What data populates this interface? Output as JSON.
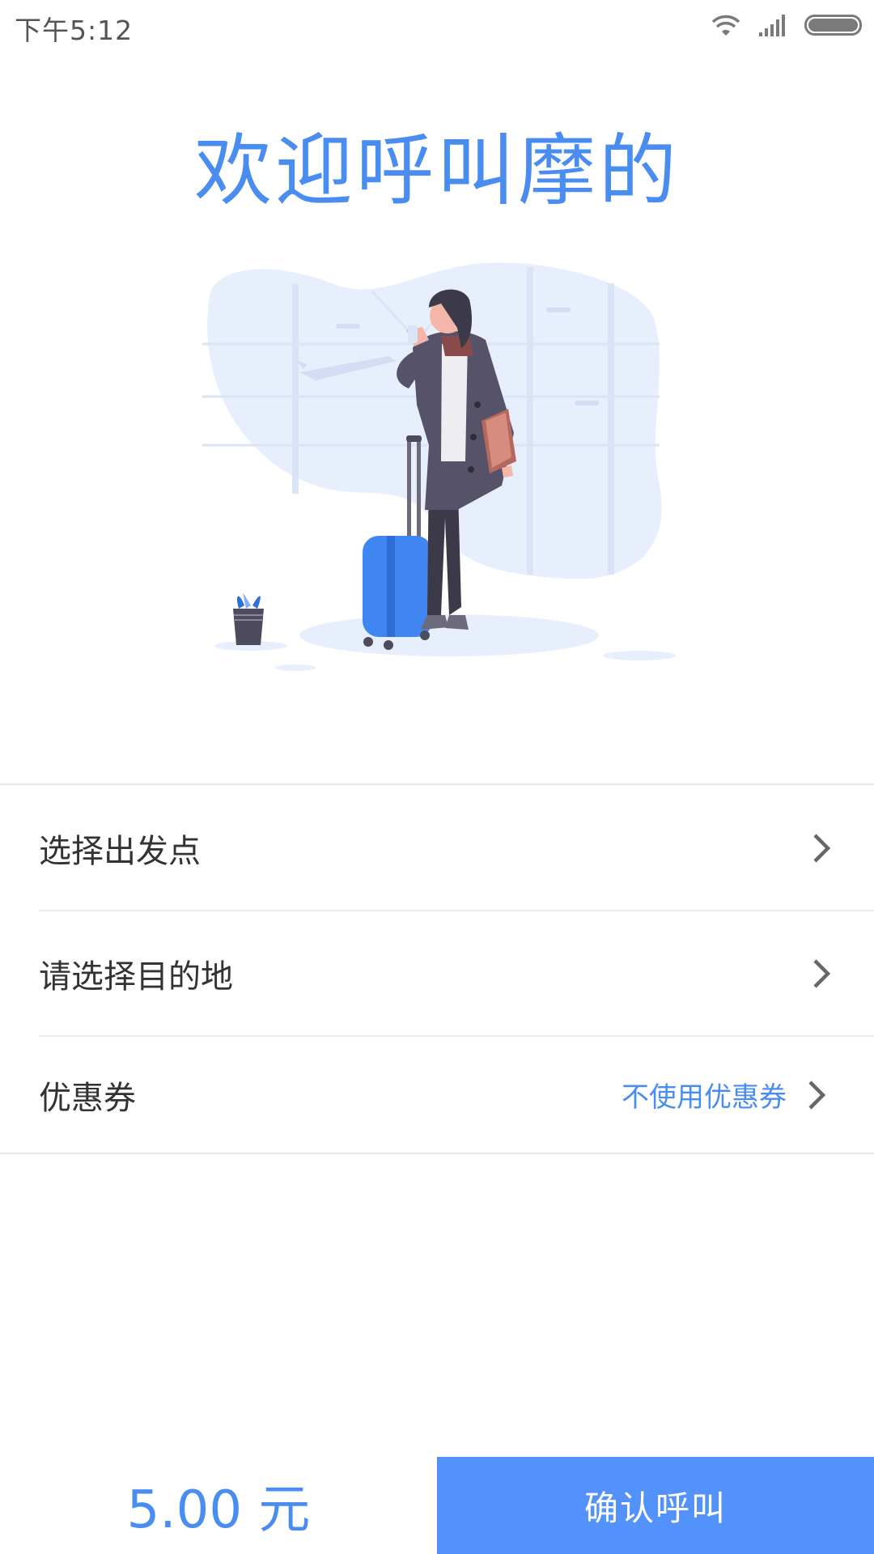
{
  "status_bar": {
    "time": "下午5:12",
    "icons": [
      "wifi-icon",
      "signal-icon",
      "battery-icon"
    ]
  },
  "title": "欢迎呼叫摩的",
  "illustration": {
    "subject": "traveler-with-suitcase-illustration"
  },
  "form": {
    "departure_label": "选择出发点",
    "destination_label": "请选择目的地",
    "coupon_label": "优惠券",
    "coupon_value": "不使用优惠券"
  },
  "footer": {
    "price": "5.00 元",
    "confirm_label": "确认呼叫"
  },
  "colors": {
    "accent": "#4a8df0",
    "button": "#5391fb",
    "text": "#333333",
    "divider": "#e8e8e8"
  }
}
